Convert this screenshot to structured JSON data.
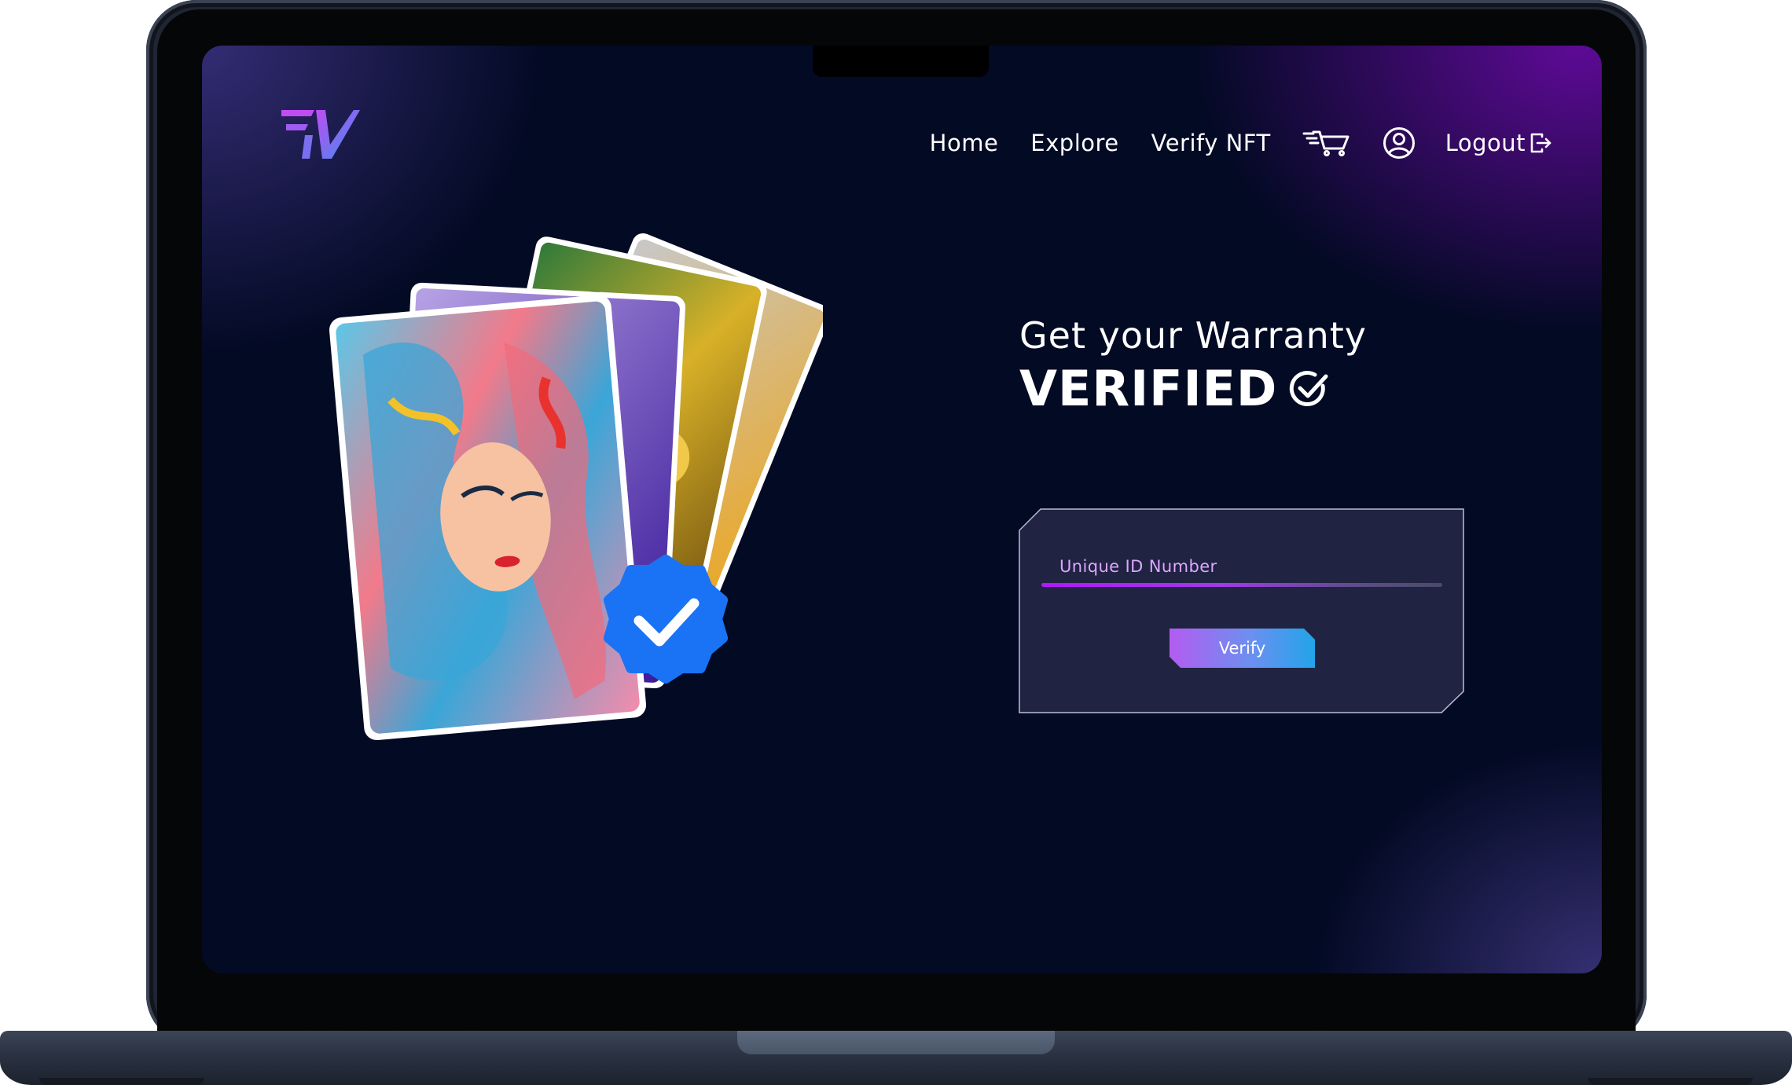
{
  "nav": {
    "links": [
      "Home",
      "Explore",
      "Verify NFT"
    ],
    "cart_icon": "cart-icon",
    "profile_icon": "user-circle-icon",
    "logout_label": "Logout",
    "logout_icon": "logout-icon"
  },
  "logo": {
    "icon": "brand-logo-icon",
    "colors": [
      "#b84cf2",
      "#3b8ef0"
    ]
  },
  "hero": {
    "headline_line1": "Get your Warranty",
    "headline_line2": "VERIFIED",
    "headline_icon": "check-circle-icon"
  },
  "form": {
    "input_placeholder": "Unique ID Number",
    "input_value": "",
    "submit_label": "Verify"
  },
  "illustration": {
    "description_icon": "nft-card-stack",
    "badge_icon": "verified-badge-icon",
    "badge_color": "#1a73f5"
  },
  "colors": {
    "background": "#030a24",
    "accent_purple": "#b515ff",
    "accent_blue": "#22a4ea"
  }
}
